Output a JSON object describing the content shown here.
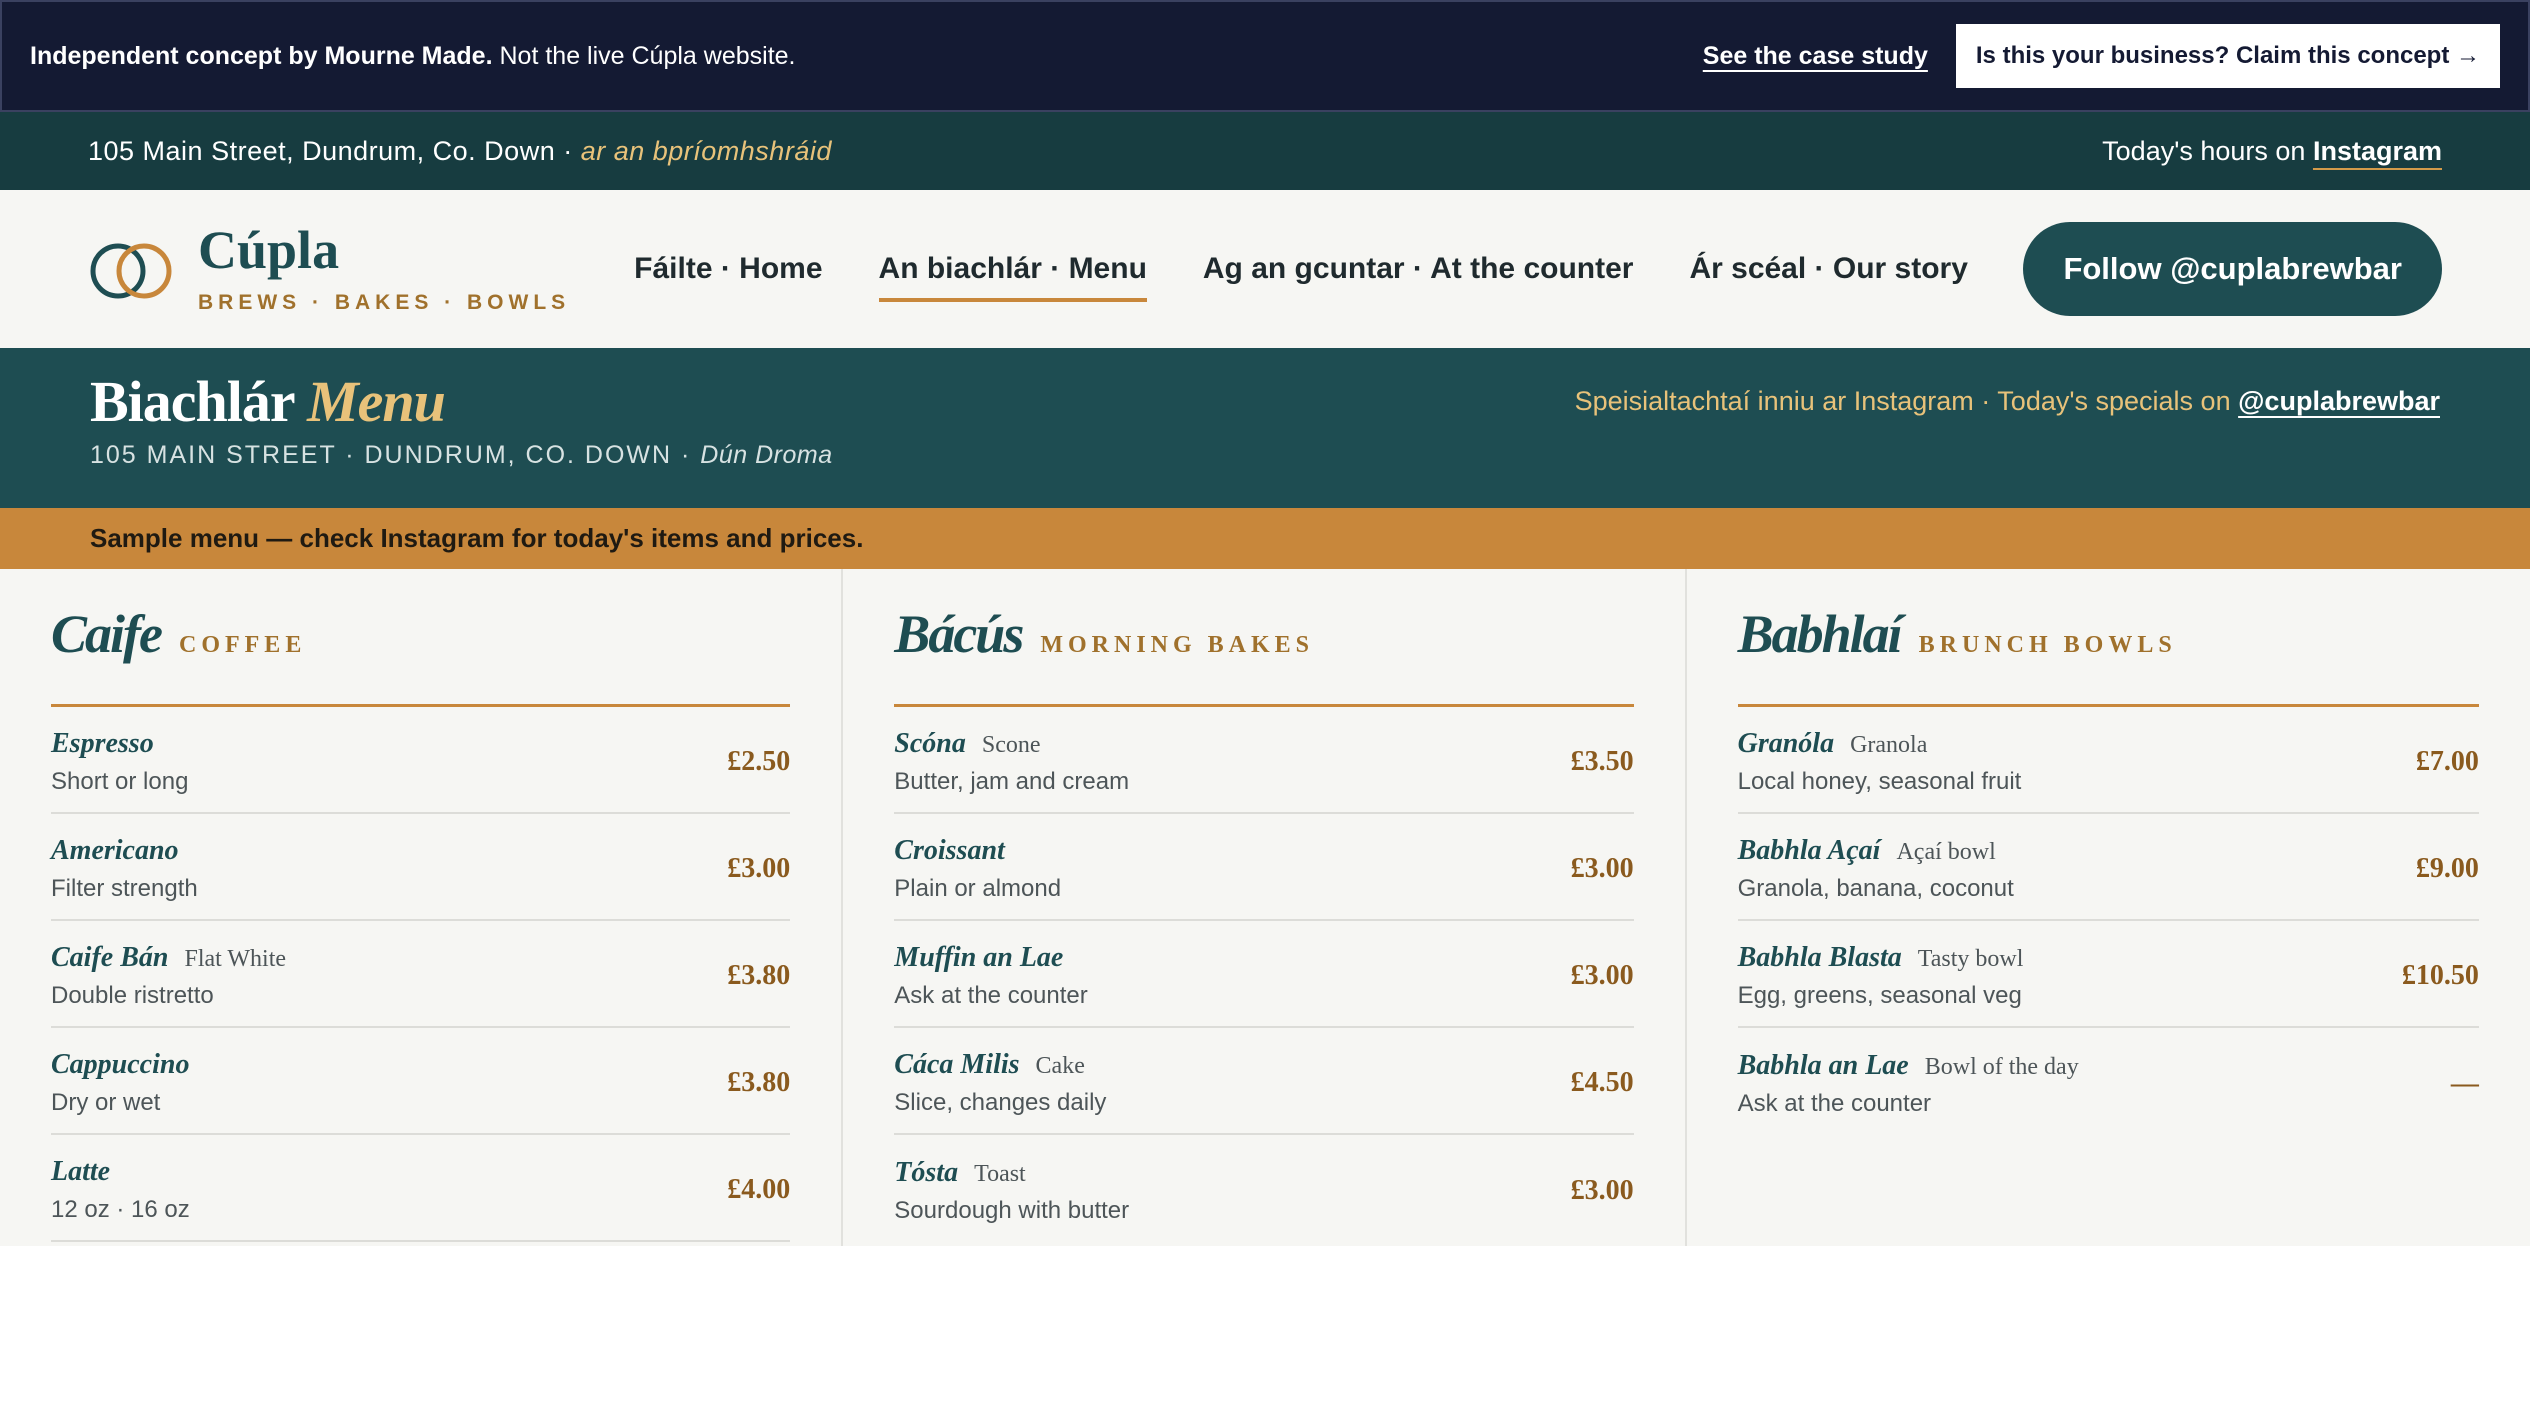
{
  "concept_bar": {
    "bold_text": "Independent concept by Mourne Made.",
    "text": "Not the live Cúpla website.",
    "case_study_link": "See the case study",
    "claim_button": "Is this your business? Claim this concept →"
  },
  "address_strip": {
    "address": "105 Main Street, Dundrum, Co. Down ·",
    "irish": "ar an bpríomhshráid",
    "hours_text": "Today's hours on",
    "hours_link": "Instagram"
  },
  "brand": {
    "name": "Cúpla",
    "tagline": "BREWS · BAKES · BOWLS",
    "colors": {
      "teal": "#1e4d52",
      "gold": "#c8873b"
    }
  },
  "nav": {
    "items": [
      {
        "label": "Fáilte · Home",
        "active": false
      },
      {
        "label": "An biachlár · Menu",
        "active": true
      },
      {
        "label": "Ag an gcuntar · At the counter",
        "active": false
      },
      {
        "label": "Ár scéal · Our story",
        "active": false
      }
    ],
    "follow_button": "Follow @cuplabrewbar"
  },
  "menu_header": {
    "title_irish": "Biachlár",
    "title_english": "Menu",
    "subtitle": "105 MAIN STREET · DUNDRUM, CO. DOWN ·",
    "subtitle_irish": "Dún Droma",
    "specials_text": "Speisialtachtaí inniu ar Instagram  ·  Today's specials on",
    "specials_handle": "@cuplabrewbar"
  },
  "notice": "Sample menu — check Instagram for today's items and prices.",
  "sections": [
    {
      "title": "Caife",
      "subtitle": "COFFEE",
      "items": [
        {
          "name": "Espresso",
          "english": "",
          "desc": "Short or long",
          "price": "£2.50"
        },
        {
          "name": "Americano",
          "english": "",
          "desc": "Filter strength",
          "price": "£3.00"
        },
        {
          "name": "Caife Bán",
          "english": "Flat White",
          "desc": "Double ristretto",
          "price": "£3.80"
        },
        {
          "name": "Cappuccino",
          "english": "",
          "desc": "Dry or wet",
          "price": "£3.80"
        },
        {
          "name": "Latte",
          "english": "",
          "desc": "12 oz · 16 oz",
          "price": "£4.00"
        }
      ]
    },
    {
      "title": "Bácús",
      "subtitle": "MORNING BAKES",
      "items": [
        {
          "name": "Scóna",
          "english": "Scone",
          "desc": "Butter, jam and cream",
          "price": "£3.50"
        },
        {
          "name": "Croissant",
          "english": "",
          "desc": "Plain or almond",
          "price": "£3.00"
        },
        {
          "name": "Muffin an Lae",
          "english": "",
          "desc": "Ask at the counter",
          "price": "£3.00"
        },
        {
          "name": "Cáca Milis",
          "english": "Cake",
          "desc": "Slice, changes daily",
          "price": "£4.50"
        },
        {
          "name": "Tósta",
          "english": "Toast",
          "desc": "Sourdough with butter",
          "price": "£3.00"
        }
      ]
    },
    {
      "title": "Babhlaí",
      "subtitle": "BRUNCH BOWLS",
      "items": [
        {
          "name": "Granóla",
          "english": "Granola",
          "desc": "Local honey, seasonal fruit",
          "price": "£7.00"
        },
        {
          "name": "Babhla Açaí",
          "english": "Açaí bowl",
          "desc": "Granola, banana, coconut",
          "price": "£9.00"
        },
        {
          "name": "Babhla Blasta",
          "english": "Tasty bowl",
          "desc": "Egg, greens, seasonal veg",
          "price": "£10.50"
        },
        {
          "name": "Babhla an Lae",
          "english": "Bowl of the day",
          "desc": "Ask at the counter",
          "price": "—"
        }
      ]
    }
  ]
}
